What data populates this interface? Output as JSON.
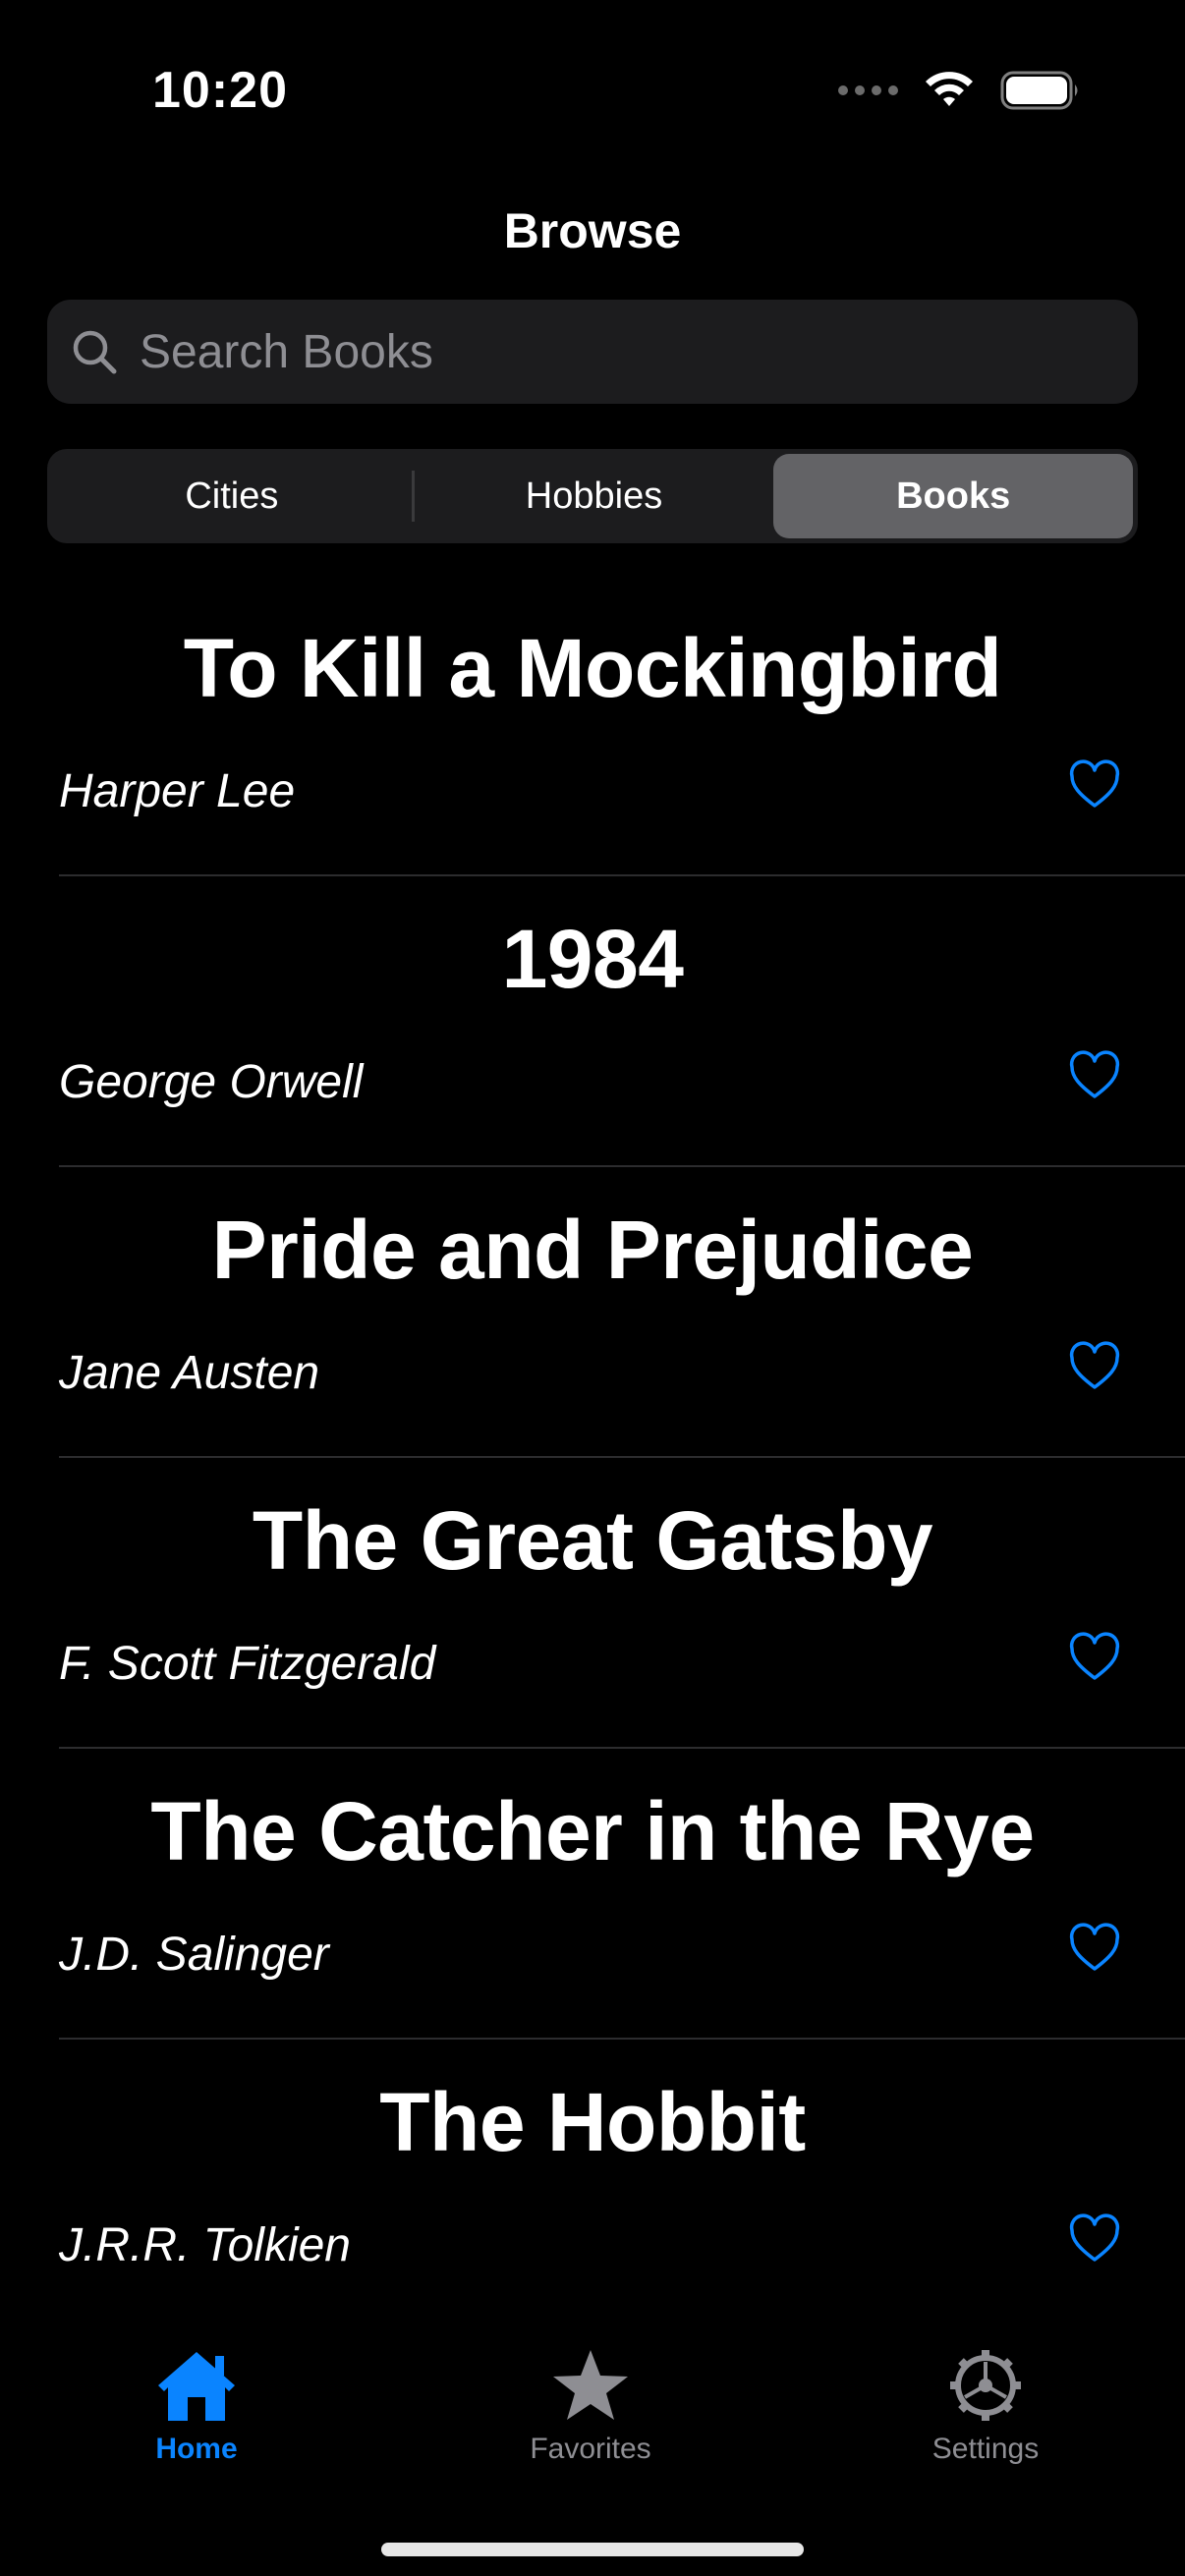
{
  "status_bar": {
    "time": "10:20"
  },
  "nav": {
    "title": "Browse"
  },
  "search": {
    "placeholder": "Search Books",
    "value": ""
  },
  "segments": [
    {
      "label": "Cities",
      "selected": false
    },
    {
      "label": "Hobbies",
      "selected": false
    },
    {
      "label": "Books",
      "selected": true
    }
  ],
  "books": [
    {
      "title": "To Kill a Mockingbird",
      "author": "Harper Lee",
      "favorited": false
    },
    {
      "title": "1984",
      "author": "George Orwell",
      "favorited": false
    },
    {
      "title": "Pride and Prejudice",
      "author": "Jane Austen",
      "favorited": false
    },
    {
      "title": "The Great Gatsby",
      "author": "F. Scott Fitzgerald",
      "favorited": false
    },
    {
      "title": "The Catcher in the Rye",
      "author": "J.D. Salinger",
      "favorited": false
    },
    {
      "title": "The Hobbit",
      "author": "J.R.R. Tolkien",
      "favorited": false
    }
  ],
  "tabbar": {
    "tabs": [
      {
        "label": "Home",
        "icon": "house-icon",
        "active": true
      },
      {
        "label": "Favorites",
        "icon": "star-icon",
        "active": false
      },
      {
        "label": "Settings",
        "icon": "gear-icon",
        "active": false
      }
    ]
  },
  "colors": {
    "accent": "#0a84ff",
    "background": "#000000",
    "inactive": "#8e8e93"
  }
}
